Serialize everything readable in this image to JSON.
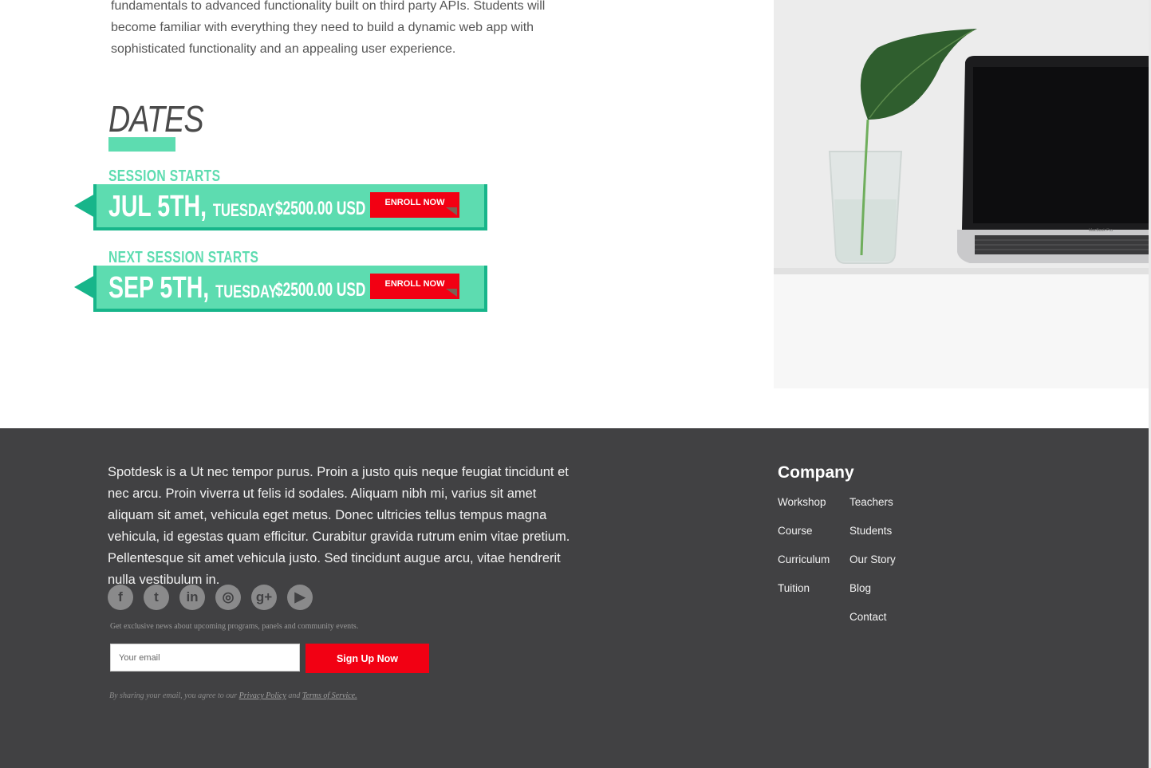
{
  "intro": {
    "text": "fundamentals to advanced functionality built on third party APIs. Students will become familiar with everything they need to build a dynamic web app with sophisticated functionality and an appealing user experience."
  },
  "dates": {
    "title": "DATES",
    "sessions": [
      {
        "label": "SESSION STARTS",
        "date": "JUL 5TH,",
        "day": "TUESDAY",
        "price": "$2500.00 USD",
        "button": "ENROLL NOW"
      },
      {
        "label": "NEXT SESSION STARTS",
        "date": "SEP 5TH,",
        "day": "TUESDAY",
        "price": "$2500.00 USD",
        "button": "ENROLL NOW"
      }
    ]
  },
  "photo": {
    "laptop_brand": "MacBook Pro"
  },
  "footer": {
    "about": "Spotdesk is a Ut nec tempor purus. Proin a justo quis neque feugiat tincidunt et nec arcu. Proin viverra ut felis id sodales. Aliquam nibh mi, varius sit amet aliquam sit amet, vehicula eget metus. Donec ultricies tellus tempus magna vehicula, id egestas quam efficitur. Curabitur gravida rutrum enim vitae pretium. Pellentesque sit amet vehicula justo. Sed tincidunt augue arcu, vitae hendrerit nulla vestibulum in.",
    "socials": [
      {
        "name": "facebook-icon",
        "glyph": "f"
      },
      {
        "name": "twitter-icon",
        "glyph": "t"
      },
      {
        "name": "linkedin-icon",
        "glyph": "in"
      },
      {
        "name": "instagram-icon",
        "glyph": "◎"
      },
      {
        "name": "google-plus-icon",
        "glyph": "g+"
      },
      {
        "name": "youtube-icon",
        "glyph": "▶"
      }
    ],
    "newsletter": {
      "note": "Get exclusive news about upcoming programs, panels and community events.",
      "placeholder": "Your email",
      "button": "Sign Up Now",
      "legal_prefix": "By sharing your email, you agree to our",
      "privacy": "Privacy Policy",
      "and": "and",
      "terms": "Terms of Service."
    },
    "company": {
      "title": "Company",
      "col1": [
        "Workshop",
        "Course",
        "Curriculum",
        "Tuition"
      ],
      "col2": [
        "Teachers",
        "Students",
        "Our Story",
        "Blog",
        "Contact"
      ]
    }
  },
  "colors": {
    "mint": "#5ddcb0",
    "teal": "#17b58a",
    "red": "#f20013",
    "footer_bg": "#414143"
  }
}
